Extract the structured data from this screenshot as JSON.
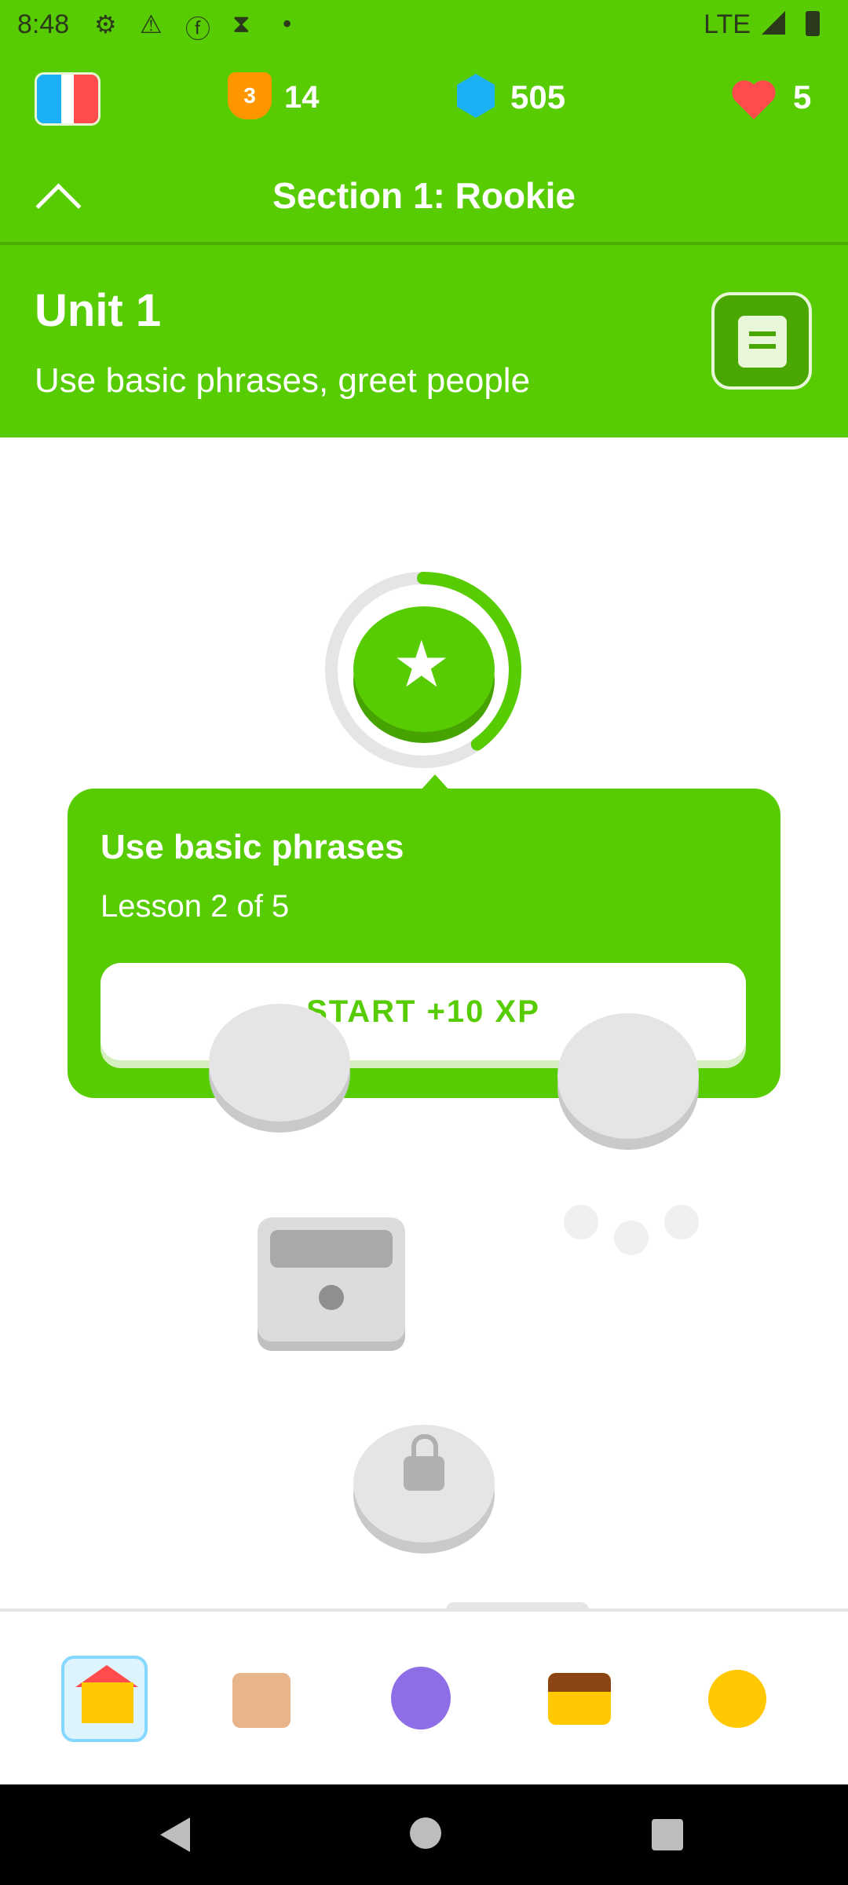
{
  "status_bar": {
    "time": "8:48",
    "network": "LTE",
    "icons": [
      "gear-icon",
      "warning-icon",
      "facebook-icon",
      "hourglass-icon",
      "dot-icon",
      "signal-icon",
      "battery-icon"
    ]
  },
  "header": {
    "course_flag": "language-flag",
    "streak": {
      "badge": "3",
      "value": "14"
    },
    "gems": "505",
    "hearts": "5",
    "section_title": "Section 1: Rookie",
    "unit_title": "Unit 1",
    "unit_description": "Use basic phrases, greet people",
    "colors": {
      "primary": "#58cc02",
      "dark": "#46a302",
      "gem": "#1cb0f6",
      "heart": "#ff4b4b",
      "streak": "#ff9600"
    }
  },
  "path": {
    "current_lesson_progress_fraction": 0.4,
    "tooltip": {
      "title": "Use basic phrases",
      "subtitle": "Lesson 2 of 5",
      "start_label": "START +10 XP"
    }
  },
  "tabs": [
    {
      "name": "home",
      "icon": "home-icon",
      "active": true
    },
    {
      "name": "letters",
      "icon": "letters-icon",
      "active": false
    },
    {
      "name": "profile",
      "icon": "profile-icon",
      "active": false
    },
    {
      "name": "leaderboard",
      "icon": "chest-icon",
      "active": false
    },
    {
      "name": "quests",
      "icon": "coin-icon",
      "active": false
    }
  ]
}
